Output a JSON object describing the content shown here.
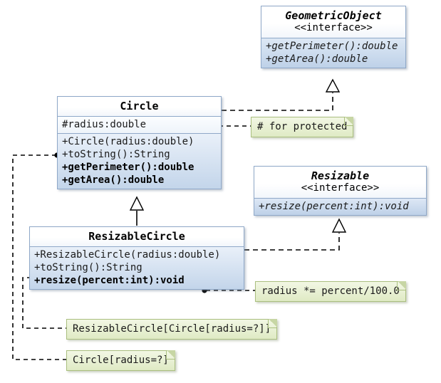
{
  "diagram": {
    "title": "UML class diagram: GeometricObject / Resizable / Circle / ResizableCircle",
    "colors": {
      "class_border": "#8fa8c8",
      "class_fill_top": "#f4f8fc",
      "class_fill_bottom": "#c3d5ea",
      "note_border": "#aabf7f",
      "note_fill_top": "#f2f7e4",
      "note_fill_bottom": "#dfeac4",
      "line": "#000000",
      "background": "#ffffff"
    }
  },
  "classes": {
    "geometric_object": {
      "name": "GeometricObject",
      "stereotype": "<<interface>>",
      "operations": [
        "+getPerimeter():double",
        "+getArea():double"
      ]
    },
    "resizable": {
      "name": "Resizable",
      "stereotype": "<<interface>>",
      "operations": [
        "+resize(percent:int):void"
      ]
    },
    "circle": {
      "name": "Circle",
      "attributes": [
        "#radius:double"
      ],
      "operations": [
        "+Circle(radius:double)",
        "+toString():String",
        "+getPerimeter():double",
        "+getArea():double"
      ]
    },
    "resizable_circle": {
      "name": "ResizableCircle",
      "operations": [
        "+ResizableCircle(radius:double)",
        "+toString():String",
        "+resize(percent:int):void"
      ]
    }
  },
  "notes": {
    "protected": "# for protected",
    "resize_body": "radius *= percent/100.0",
    "resizable_circle_tostring": "ResizableCircle[Circle[radius=?]]",
    "circle_tostring": "Circle[radius=?]"
  }
}
